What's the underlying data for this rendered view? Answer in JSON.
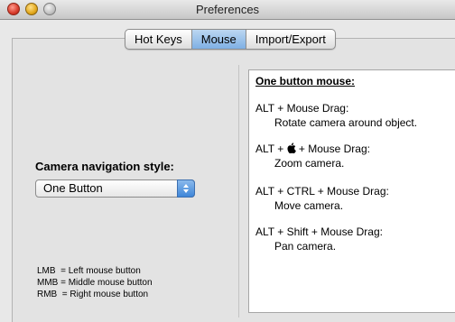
{
  "window": {
    "title": "Preferences"
  },
  "tabs": [
    {
      "label": "Hot Keys",
      "active": false
    },
    {
      "label": "Mouse",
      "active": true
    },
    {
      "label": "Import/Export",
      "active": false
    }
  ],
  "navigation": {
    "label": "Camera navigation style:",
    "selected": "One Button"
  },
  "legend": [
    "LMB  = Left mouse button",
    "MMB = Middle mouse button",
    "RMB  = Right mouse button"
  ],
  "help": {
    "heading": "One button mouse:",
    "items": [
      {
        "combo": "ALT + Mouse Drag:",
        "desc": "Rotate camera around object."
      },
      {
        "combo_prefix": "ALT + ",
        "combo_suffix": " + Mouse Drag:",
        "icon": "apple-icon",
        "desc": "Zoom camera."
      },
      {
        "combo": "ALT + CTRL + Mouse Drag:",
        "desc": "Move camera."
      },
      {
        "combo": "ALT + Shift + Mouse Drag:",
        "desc": "Pan camera."
      }
    ]
  },
  "colors": {
    "active_tab": "#7fb0e4",
    "stepper": "#3f86d8"
  }
}
